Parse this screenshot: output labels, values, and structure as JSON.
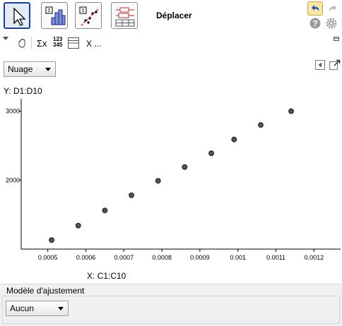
{
  "toolbar": {
    "tools": [
      {
        "icon": "pointer-icon"
      },
      {
        "icon": "histogram-icon"
      },
      {
        "icon": "scatter-fit-icon"
      },
      {
        "icon": "boxplot-icon"
      }
    ],
    "mode_caption": "Déplacer",
    "undo_icon": "undo-icon",
    "redo_icon": "redo-icon",
    "help_icon": "help-icon",
    "settings_icon": "gear-icon"
  },
  "style_bar": {
    "sigma_label": "Σx",
    "digits_top": "123",
    "digits_bottom": "345",
    "x_label": "X ..."
  },
  "plot_type": {
    "selected": "Nuage"
  },
  "plot": {
    "y_axis_title": "Y:  D1:D10",
    "x_axis_title": "X:  C1:C10"
  },
  "regression": {
    "title": "Modèle d'ajustement",
    "selected": "Aucun"
  },
  "colors": {
    "accent": "#1a3f8f",
    "point_fill": "#555555",
    "panel": "#f0f0f0"
  },
  "chart_data": {
    "type": "scatter",
    "title": "",
    "xlabel": "X:  C1:C10",
    "ylabel": "Y:  D1:D10",
    "x": [
      0.00051,
      0.00058,
      0.00065,
      0.00072,
      0.00079,
      0.00086,
      0.00093,
      0.00099,
      0.00106,
      0.00114
    ],
    "y": [
      1130,
      1340,
      1560,
      1780,
      1990,
      2190,
      2390,
      2590,
      2800,
      3000
    ],
    "xlim": [
      0.00043,
      0.00127
    ],
    "ylim": [
      1000,
      3180
    ],
    "x_ticks": [
      "0.0005",
      "0.0006",
      "0.0007",
      "0.0008",
      "0.0009",
      "0.001",
      "0.0011",
      "0.0012"
    ],
    "x_tick_values": [
      0.0005,
      0.0006,
      0.0007,
      0.0008,
      0.0009,
      0.001,
      0.0011,
      0.0012
    ],
    "y_ticks": [
      "2000",
      "3000"
    ],
    "y_tick_values": [
      2000,
      3000
    ],
    "grid": false,
    "legend": "none"
  }
}
